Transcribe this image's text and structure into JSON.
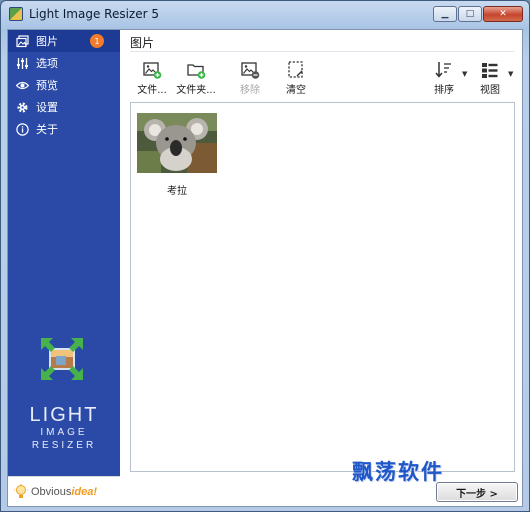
{
  "window": {
    "title": "Light Image Resizer 5",
    "minimize_glyph": "▁",
    "maximize_glyph": "□",
    "close_glyph": "✕"
  },
  "sidebar": {
    "items": [
      {
        "label": "图片",
        "icon": "images-icon",
        "badge": "1",
        "active": true
      },
      {
        "label": "选项",
        "icon": "sliders-icon"
      },
      {
        "label": "预览",
        "icon": "eye-icon"
      },
      {
        "label": "设置",
        "icon": "gear-icon"
      },
      {
        "label": "关于",
        "icon": "info-icon"
      }
    ],
    "brand": {
      "line1": "LIGHT",
      "line2": "IMAGE",
      "line3": "RESIZER"
    },
    "vendor": {
      "prefix": "Obvious",
      "suffix": "idea!"
    }
  },
  "main": {
    "section_title": "图片",
    "toolbar": {
      "add_file": "文件...",
      "add_folder": "文件夹...",
      "remove": "移除",
      "clear": "清空",
      "sort": "排序",
      "view": "视图"
    },
    "images": [
      {
        "label": "考拉",
        "thumbnail": "koala-photo"
      }
    ],
    "next_button": "下一步 >"
  },
  "watermark": "飘荡软件",
  "colors": {
    "sidebar_bg": "#2b4aa8",
    "badge": "#f37b2b",
    "watermark": "#1f57c9",
    "add_green": "#3bb54a"
  }
}
